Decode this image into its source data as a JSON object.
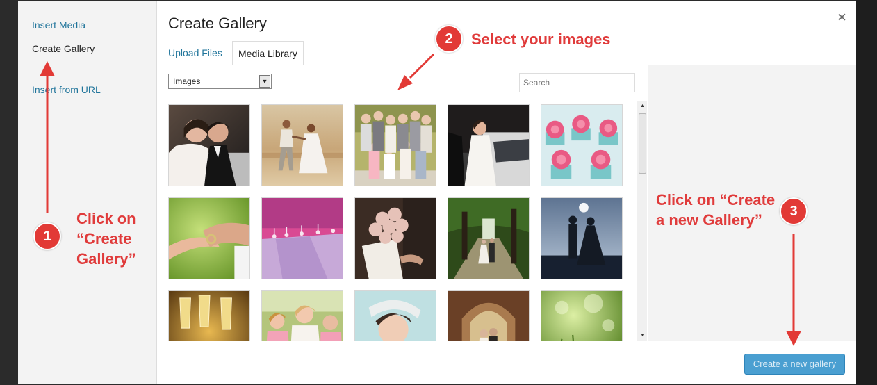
{
  "menu": {
    "items": [
      {
        "label": "Insert Media"
      },
      {
        "label": "Create Gallery"
      },
      {
        "label": "Insert from URL"
      }
    ]
  },
  "header": {
    "title": "Create Gallery",
    "close_glyph": "×",
    "tabs": [
      {
        "label": "Upload Files"
      },
      {
        "label": "Media Library"
      }
    ]
  },
  "toolbar": {
    "filter_value": "Images",
    "search_placeholder": "Search"
  },
  "footer": {
    "primary_button": "Create a new gallery"
  },
  "annotations": {
    "step1": {
      "number": "1",
      "text_lines": [
        "Click on",
        "“Create",
        "Gallery”"
      ]
    },
    "step2": {
      "number": "2",
      "text": "Select your images"
    },
    "step3": {
      "number": "3",
      "text_lines": [
        "Click on “Create",
        "a new Gallery”"
      ]
    },
    "color": "#e23a36"
  },
  "gallery": {
    "thumbnails": [
      {
        "name": "bride-groom-car"
      },
      {
        "name": "couple-running-beach"
      },
      {
        "name": "wedding-family-portrait"
      },
      {
        "name": "bride-limousine"
      },
      {
        "name": "pink-rose-cupcakes"
      },
      {
        "name": "ring-hands"
      },
      {
        "name": "purple-reception-tables"
      },
      {
        "name": "bridal-bouquet-hands"
      },
      {
        "name": "couple-tree-path"
      },
      {
        "name": "couple-silhouette-moon"
      },
      {
        "name": "champagne-glasses"
      },
      {
        "name": "bridesmaids-smiling"
      },
      {
        "name": "bride-veil"
      },
      {
        "name": "couple-archway"
      },
      {
        "name": "green-bokeh-grass"
      }
    ]
  },
  "colors": {
    "link": "#21759b",
    "primary_button": "#4a9fd1",
    "annotation_red": "#e03b3b"
  }
}
